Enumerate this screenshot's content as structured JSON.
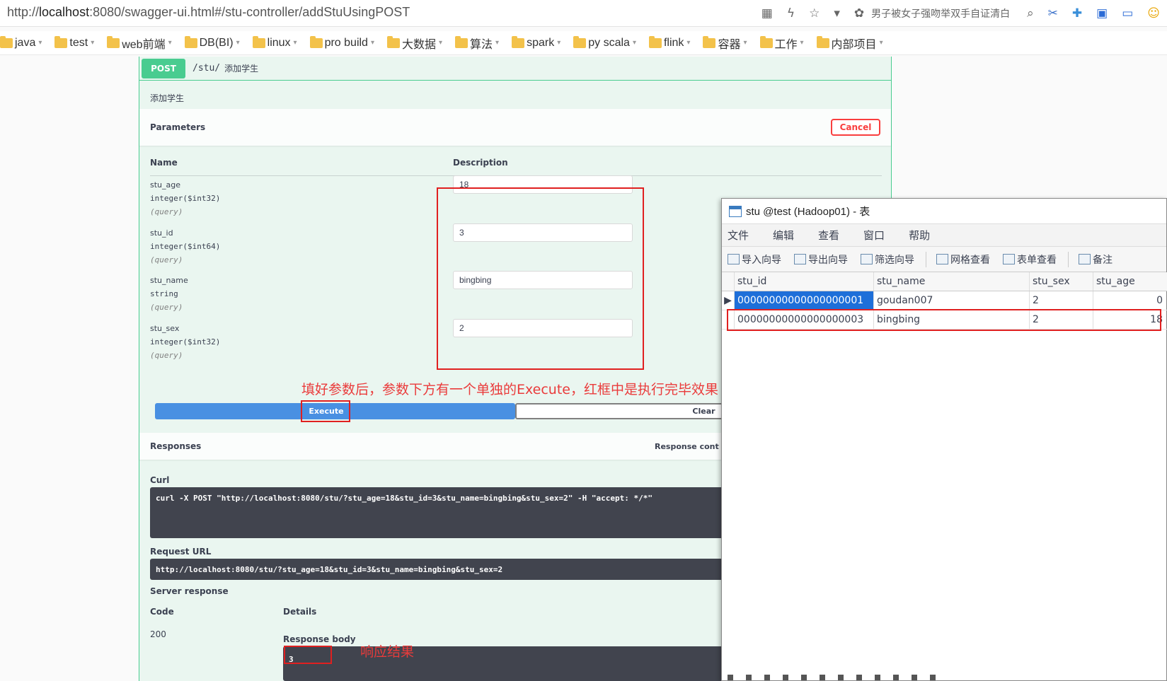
{
  "browser": {
    "url_prefix": "http://",
    "url_host": "localhost",
    "url_rest": ":8080/swagger-ui.html#/stu-controller/addStuUsingPOST",
    "news_text": "男子被女子强吻举双手自证清白"
  },
  "bookmarks": [
    {
      "label": "java"
    },
    {
      "label": "test"
    },
    {
      "label": "web前端"
    },
    {
      "label": "DB(BI)"
    },
    {
      "label": "linux"
    },
    {
      "label": "pro build"
    },
    {
      "label": "大数据"
    },
    {
      "label": "算法"
    },
    {
      "label": "spark"
    },
    {
      "label": "py scala"
    },
    {
      "label": "flink"
    },
    {
      "label": "容器"
    },
    {
      "label": "工作"
    },
    {
      "label": "内部项目"
    }
  ],
  "swagger": {
    "method": "POST",
    "path": "/stu/",
    "summary": "添加学生",
    "description": "添加学生",
    "parameters_title": "Parameters",
    "cancel_label": "Cancel",
    "col_name": "Name",
    "col_description": "Description",
    "params": [
      {
        "name": "stu_age",
        "type": "integer($int32)",
        "in": "(query)",
        "value": "18"
      },
      {
        "name": "stu_id",
        "type": "integer($int64)",
        "in": "(query)",
        "value": "3"
      },
      {
        "name": "stu_name",
        "type": "string",
        "in": "(query)",
        "value": "bingbing"
      },
      {
        "name": "stu_sex",
        "type": "integer($int32)",
        "in": "(query)",
        "value": "2"
      }
    ],
    "execute_label": "Execute",
    "clear_label": "Clear",
    "responses_title": "Responses",
    "response_content_label": "Response cont",
    "curl_label": "Curl",
    "curl_cmd": "curl -X POST \"http://localhost:8080/stu/?stu_age=18&stu_id=3&stu_name=bingbing&stu_sex=2\" -H \"accept: */*\"",
    "request_url_label": "Request URL",
    "request_url": "http://localhost:8080/stu/?stu_age=18&stu_id=3&stu_name=bingbing&stu_sex=2",
    "server_response_label": "Server response",
    "code_label": "Code",
    "details_label": "Details",
    "code_value": "200",
    "response_body_label": "Response body",
    "response_body": "3"
  },
  "annotations": {
    "execute_note": "填好参数后，参数下方有一个单独的Execute，红框中是执行完毕效果",
    "response_note": "响应结果"
  },
  "navicat": {
    "title": "stu @test (Hadoop01) - 表",
    "menu": [
      "文件",
      "编辑",
      "查看",
      "窗口",
      "帮助"
    ],
    "toolbar": [
      "导入向导",
      "导出向导",
      "筛选向导",
      "网格查看",
      "表单查看",
      "备注"
    ],
    "columns": [
      "stu_id",
      "stu_name",
      "stu_sex",
      "stu_age"
    ],
    "rows": [
      {
        "stu_id": "00000000000000000001",
        "stu_name": "goudan007",
        "stu_sex": "2",
        "stu_age": "0"
      },
      {
        "stu_id": "00000000000000000003",
        "stu_name": "bingbing",
        "stu_sex": "2",
        "stu_age": "18"
      }
    ]
  },
  "colors": {
    "post": "#49cc90",
    "execute": "#4990e2",
    "cancel": "#f93e3e",
    "annotation": "#e02020"
  }
}
